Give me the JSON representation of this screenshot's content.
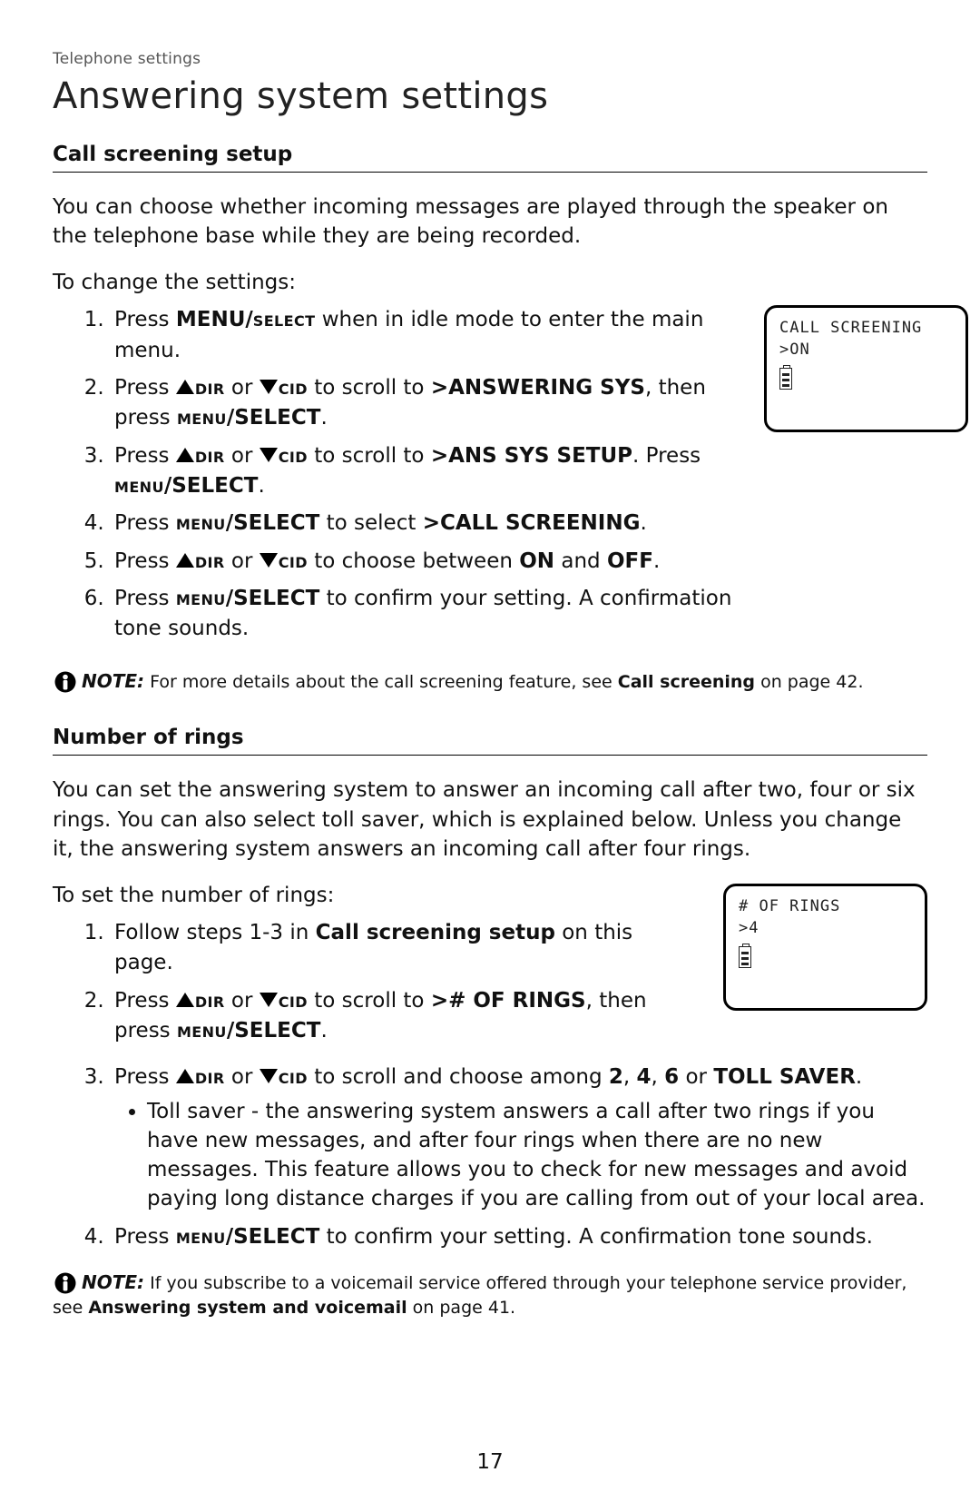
{
  "breadcrumb": "Telephone settings",
  "page_title": "Answering system settings",
  "page_number": "17",
  "sections": {
    "call_screening": {
      "heading": "Call screening setup",
      "intro": "You can choose whether incoming messages are played through the speaker on the telephone base while they are being recorded.",
      "lead": "To change the settings:",
      "steps": {
        "s1_a": "Press ",
        "s1_key": "MENU/",
        "s1_key_sc": "select",
        "s1_b": " when in idle mode to enter the main menu.",
        "s2_a": "Press ",
        "s2_dir": "dir",
        "s2_mid": " or ",
        "s2_cid": "cid",
        "s2_b": " to scroll to ",
        "s2_target": ">ANSWERING SYS",
        "s2_c": ", then press ",
        "s2_key_sc": "menu",
        "s2_key": "/SELECT",
        "s2_d": ".",
        "s3_a": "Press ",
        "s3_dir": "dir",
        "s3_mid": " or ",
        "s3_cid": "cid",
        "s3_b": " to scroll to ",
        "s3_target": ">ANS SYS SETUP",
        "s3_c": ". Press ",
        "s3_key_sc": "menu",
        "s3_key": "/SELECT",
        "s3_d": ".",
        "s4_a": "Press ",
        "s4_key_sc": "menu",
        "s4_key": "/SELECT",
        "s4_b": " to select ",
        "s4_target": ">CALL SCREENING",
        "s4_c": ".",
        "s5_a": "Press ",
        "s5_dir": "dir",
        "s5_mid": " or ",
        "s5_cid": "cid",
        "s5_b": " to choose between ",
        "s5_on": "ON",
        "s5_c": " and ",
        "s5_off": "OFF",
        "s5_d": ".",
        "s6_a": "Press ",
        "s6_key_sc": "menu",
        "s6_key": "/SELECT",
        "s6_b": " to confirm your setting. A confirmation tone sounds."
      },
      "note": {
        "label": "NOTE:",
        "text_a": " For more details about the call screening feature, see ",
        "link": "Call screening",
        "text_b": " on page 42."
      },
      "lcd": {
        "line1": "CALL SCREENING",
        "line2": ">ON"
      }
    },
    "rings": {
      "heading": "Number of rings",
      "intro": "You can set the answering system to answer an incoming call after two, four or six rings. You can also select toll saver, which is explained below. Unless you change it, the answering system answers an incoming call after four rings.",
      "lead": "To set the number of rings:",
      "steps": {
        "s1_a": "Follow steps 1-3 in ",
        "s1_link": "Call screening setup",
        "s1_b": " on this page.",
        "s2_a": "Press ",
        "s2_dir": "dir",
        "s2_mid": " or ",
        "s2_cid": "cid",
        "s2_b": " to scroll to ",
        "s2_target": "># OF RINGS",
        "s2_c": ", then press ",
        "s2_key_sc": "menu",
        "s2_key": "/SELECT",
        "s2_d": ".",
        "s3_a": "Press ",
        "s3_dir": "dir",
        "s3_mid": " or ",
        "s3_cid": "cid",
        "s3_b": " to scroll and choose among ",
        "s3_v2": "2",
        "s3_v4": "4",
        "s3_v6": "6",
        "s3_or": " or ",
        "s3_ts": "TOLL SAVER",
        "s3_d": ".",
        "bullet": "Toll saver - the answering system answers a call after two rings if you have new messages, and after four rings when there are no new messages. This feature allows you to check for new messages and avoid paying long distance charges if you are calling from out of your local area.",
        "s4_a": "Press ",
        "s4_key_sc": "menu",
        "s4_key": "/SELECT",
        "s4_b": " to confirm your setting. A confirmation tone sounds."
      },
      "note": {
        "label": "NOTE:",
        "text_a": " If you subscribe to a voicemail service offered through your telephone service provider, see ",
        "link": "Answering system and voicemail",
        "text_b": " on page 41."
      },
      "lcd": {
        "line1": "# OF RINGS",
        "line2": ">4"
      }
    }
  },
  "comma": ", "
}
